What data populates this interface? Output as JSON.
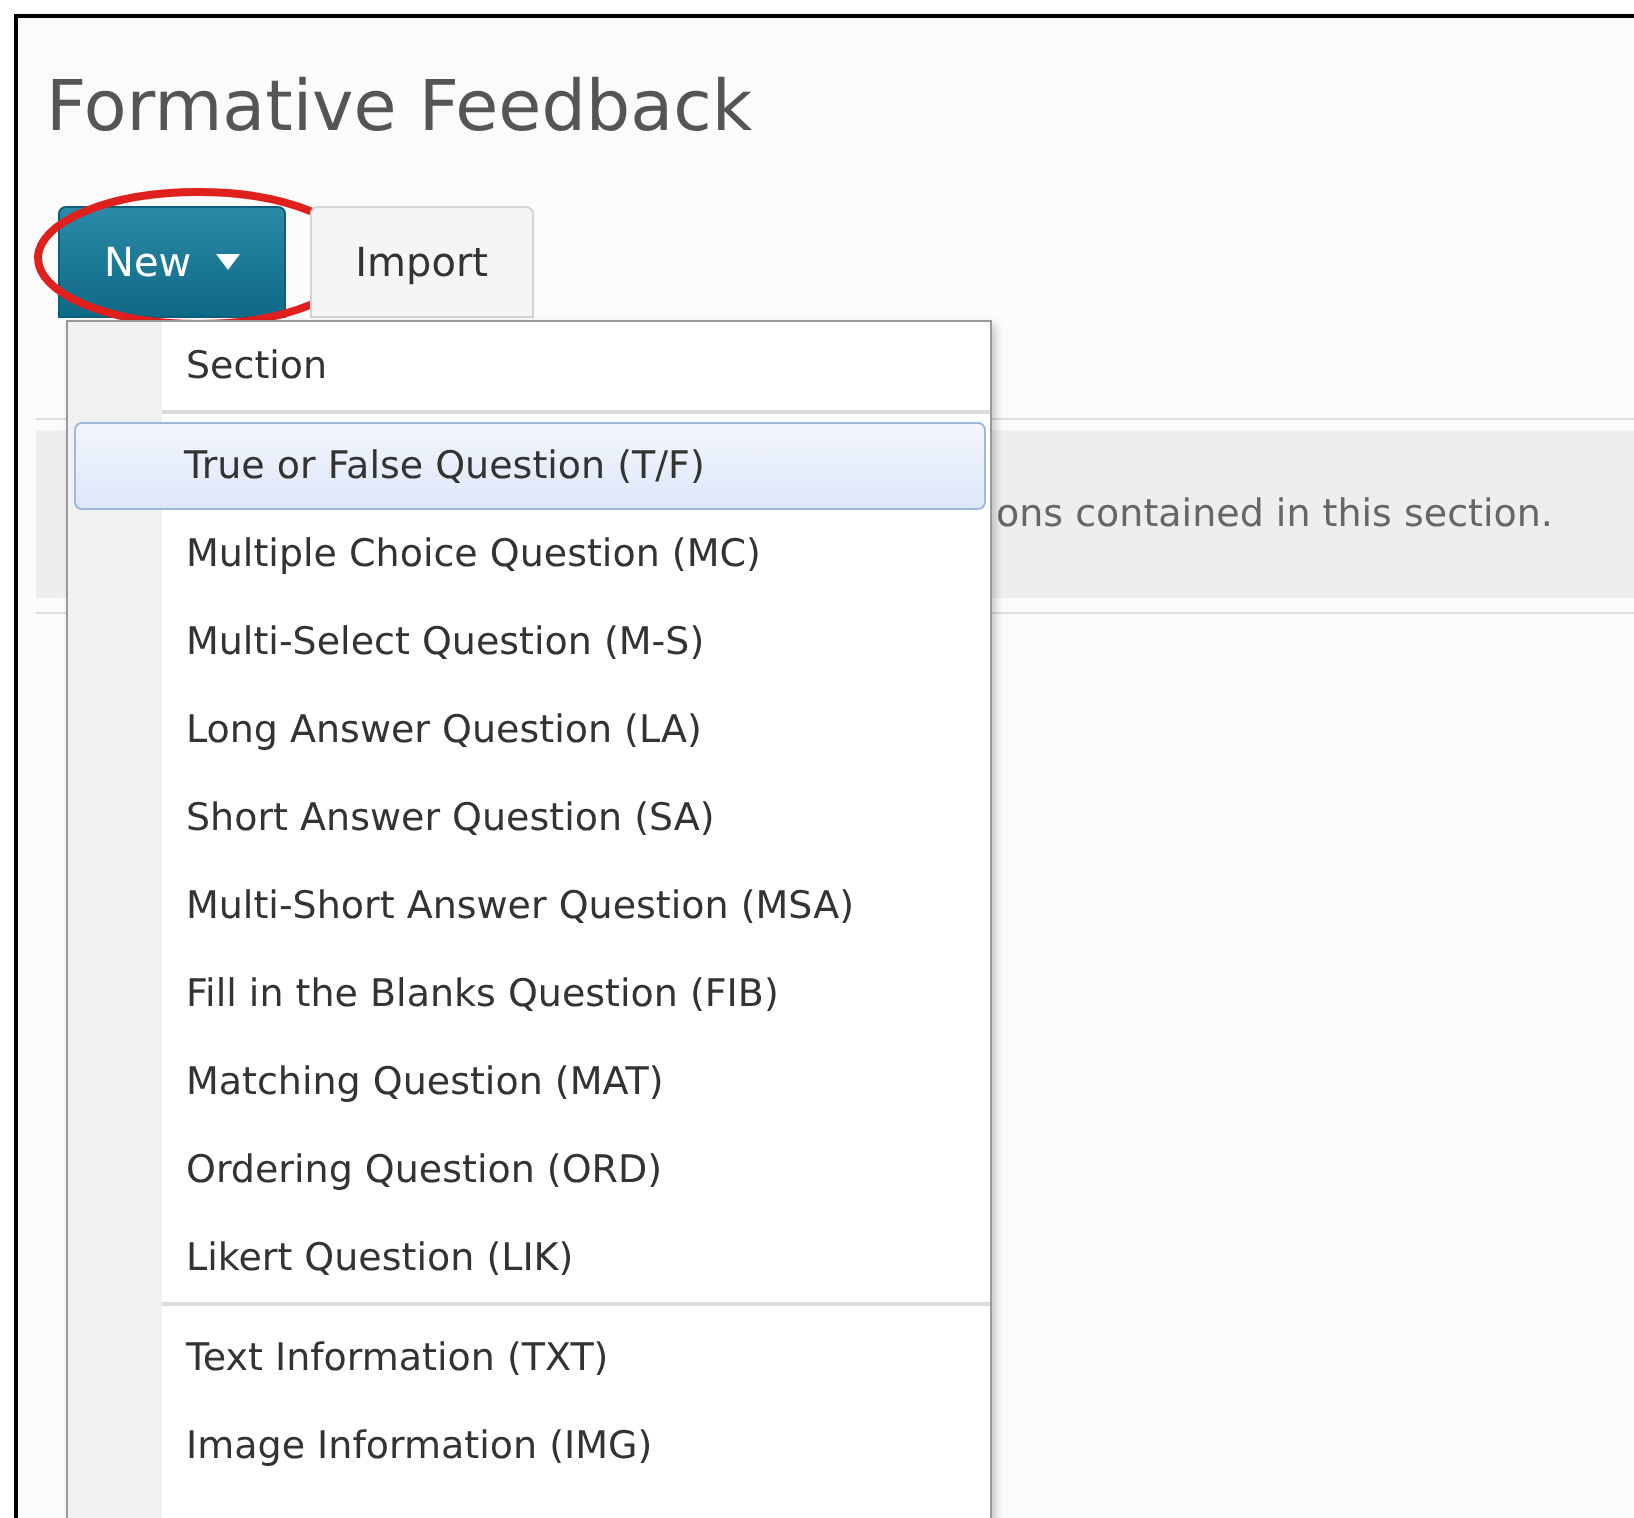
{
  "page": {
    "title": "Formative Feedback"
  },
  "toolbar": {
    "buttons": [
      {
        "label": "New",
        "kind": "dropdown",
        "highlighted": true
      },
      {
        "label": "Import",
        "kind": "plain",
        "highlighted": false
      }
    ]
  },
  "section_notice": {
    "text": "ons contained in this section."
  },
  "new_menu": {
    "groups": [
      [
        {
          "label": "Section",
          "selected": false
        }
      ],
      [
        {
          "label": "True or False Question (T/F)",
          "selected": true
        },
        {
          "label": "Multiple Choice Question (MC)",
          "selected": false
        },
        {
          "label": "Multi-Select Question (M-S)",
          "selected": false
        },
        {
          "label": "Long Answer Question (LA)",
          "selected": false
        },
        {
          "label": "Short Answer Question (SA)",
          "selected": false
        },
        {
          "label": "Multi-Short Answer Question (MSA)",
          "selected": false
        },
        {
          "label": "Fill in the Blanks Question (FIB)",
          "selected": false
        },
        {
          "label": "Matching Question (MAT)",
          "selected": false
        },
        {
          "label": "Ordering Question (ORD)",
          "selected": false
        },
        {
          "label": "Likert Question (LIK)",
          "selected": false
        }
      ],
      [
        {
          "label": "Text Information (TXT)",
          "selected": false
        },
        {
          "label": "Image Information (IMG)",
          "selected": false
        }
      ]
    ]
  }
}
